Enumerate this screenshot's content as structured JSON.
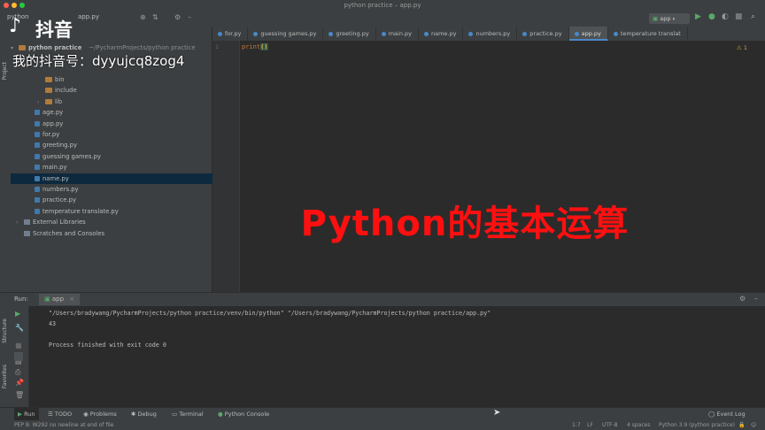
{
  "window": {
    "title": "python practice – app.py"
  },
  "watermark": {
    "brand": "抖音",
    "account": "我的抖音号：dyyujcq8zog4"
  },
  "overlay_caption": "Python的基本运算",
  "toolbar": {
    "project_label": "python",
    "run_config": "app",
    "breadcrumb": "app.py"
  },
  "editor_tabs": [
    {
      "label": "for.py",
      "active": false
    },
    {
      "label": "guessing games.py",
      "active": false
    },
    {
      "label": "greeting.py",
      "active": false
    },
    {
      "label": "main.py",
      "active": false
    },
    {
      "label": "name.py",
      "active": false
    },
    {
      "label": "numbers.py",
      "active": false
    },
    {
      "label": "practice.py",
      "active": false
    },
    {
      "label": "app.py",
      "active": true
    },
    {
      "label": "temperature translat",
      "active": false
    }
  ],
  "sidebar": {
    "panel_title": "Project",
    "root": "python practice",
    "root_path": "~/PycharmProjects/python practice",
    "items": [
      {
        "label": "bin",
        "type": "folder",
        "indent": 2
      },
      {
        "label": "include",
        "type": "folder",
        "indent": 2
      },
      {
        "label": "lib",
        "type": "folder",
        "indent": 2,
        "collapsed": true
      },
      {
        "label": "age.py",
        "type": "py",
        "indent": 1
      },
      {
        "label": "app.py",
        "type": "py",
        "indent": 1
      },
      {
        "label": "for.py",
        "type": "py",
        "indent": 1
      },
      {
        "label": "greeting.py",
        "type": "py",
        "indent": 1
      },
      {
        "label": "guessing games.py",
        "type": "py",
        "indent": 1
      },
      {
        "label": "main.py",
        "type": "py",
        "indent": 1
      },
      {
        "label": "name.py",
        "type": "py",
        "indent": 1,
        "selected": true
      },
      {
        "label": "numbers.py",
        "type": "py",
        "indent": 1
      },
      {
        "label": "practice.py",
        "type": "py",
        "indent": 1
      },
      {
        "label": "temperature translate.py",
        "type": "py",
        "indent": 1
      },
      {
        "label": "External Libraries",
        "type": "lib",
        "indent": 0,
        "collapsed": true
      },
      {
        "label": "Scratches and Consoles",
        "type": "lib",
        "indent": 0
      }
    ]
  },
  "editor": {
    "line_numbers": [
      "1"
    ],
    "code_lines": [
      {
        "keyword": "print",
        "rest": "()"
      }
    ],
    "inspection_badge": "⚠ 1"
  },
  "run_panel": {
    "label": "Run:",
    "config": "app",
    "output_lines": [
      "\"/Users/bradywang/PycharmProjects/python practice/venv/bin/python\" \"/Users/bradywang/PycharmProjects/python practice/app.py\"",
      "43",
      "",
      "Process finished with exit code 0"
    ]
  },
  "side_labels": {
    "structure": "Structure",
    "favorites": "Favorites",
    "project": "Project"
  },
  "bottom_tabs": [
    {
      "label": "Run"
    },
    {
      "label": "TODO"
    },
    {
      "label": "Problems"
    },
    {
      "label": "Debug"
    },
    {
      "label": "Terminal"
    },
    {
      "label": "Python Console"
    },
    {
      "label": "Event Log"
    }
  ],
  "status_bar": {
    "message": "PEP 8: W292 no newline at end of file",
    "position": "1:7",
    "line_sep": "LF",
    "encoding": "UTF-8",
    "indent": "4 spaces",
    "interpreter": "Python 3.9 (python practice)"
  },
  "colors": {
    "accent": "#4a88c7",
    "overlay": "#ff1010",
    "run_green": "#59a869"
  }
}
